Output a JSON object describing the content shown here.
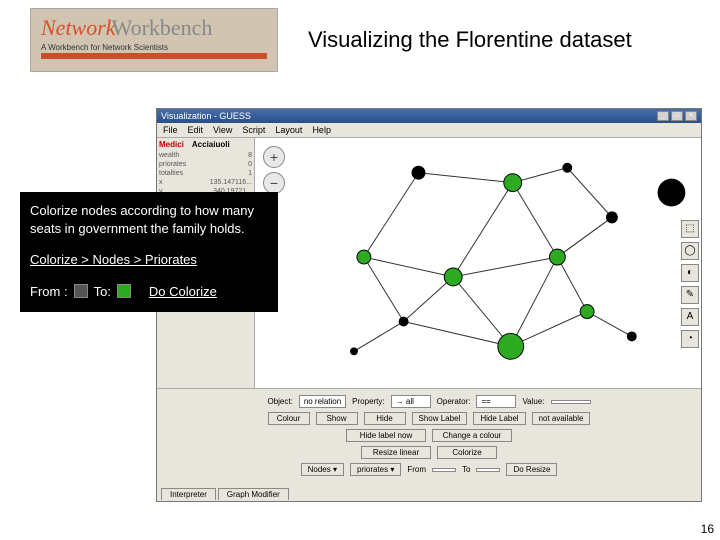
{
  "logo": {
    "name": "Network",
    "name2": "Workbench",
    "sub": "A Workbench for Network Scientists"
  },
  "slide": {
    "title": "Visualizing the Florentine dataset",
    "page": "16"
  },
  "overlay": {
    "desc": "Colorize nodes according to how many seats in government the family holds.",
    "path": "Colorize > Nodes > Priorates",
    "from_label": "From :",
    "to_label": "To:",
    "action": "Do Colorize",
    "from_color": "#555555",
    "to_color": "#2eaa22"
  },
  "window": {
    "title": "Visualization - GUESS",
    "menus": [
      "File",
      "Edit",
      "View",
      "Script",
      "Layout",
      "Help"
    ],
    "left_headers": [
      "Medici",
      "Acciaiuoli"
    ],
    "left_rows": [
      [
        "wealth",
        "8"
      ],
      [
        "priorates",
        "0"
      ],
      [
        "totalties",
        "1"
      ],
      [
        "x",
        "135.147116..."
      ],
      [
        "y",
        "340.19721..."
      ]
    ],
    "tools": [
      "⬚",
      "◯",
      "◐",
      "✎",
      "A",
      "◔"
    ],
    "bottom": {
      "row1_labels": [
        "Object:",
        "Property:",
        "Operator:",
        "Value:"
      ],
      "row1_values": [
        "no relation",
        "→ all",
        "==",
        ""
      ],
      "row2": [
        "Colour",
        "Show",
        "Hide",
        "Show Label",
        "Hide Label",
        "not available"
      ],
      "row3_left": "Hide label now",
      "row3_right": "Change a colour",
      "row4_left": "Resize linear",
      "row4_right": "Colorize",
      "row5": [
        "Nodes ▾",
        "priorates ▾",
        "From",
        "",
        "To",
        "",
        "Do Resize"
      ]
    },
    "tabs": [
      "Interpreter",
      "Graph Modifier"
    ]
  }
}
